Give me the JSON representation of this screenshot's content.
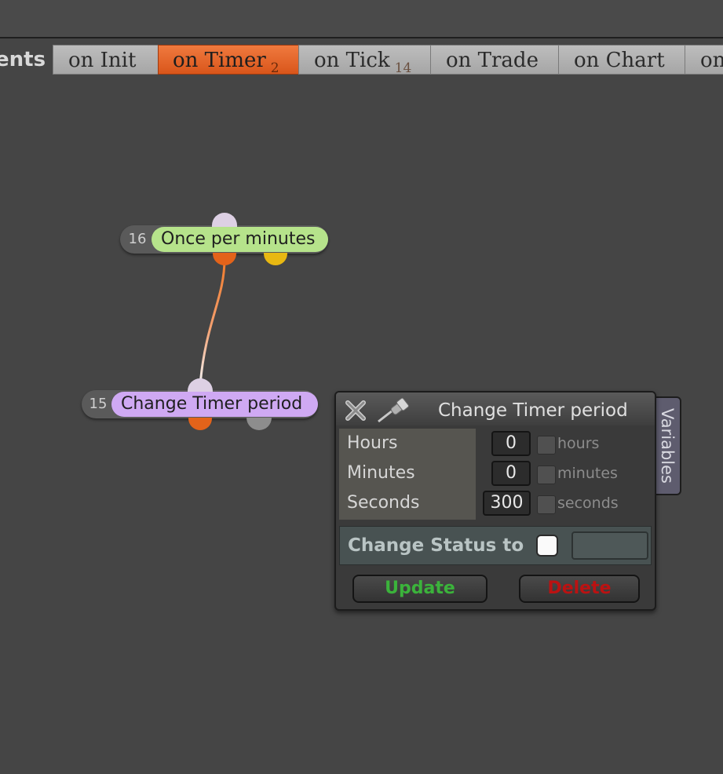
{
  "tabs": [
    {
      "label": "ents",
      "badge": ""
    },
    {
      "label": "on Init",
      "badge": ""
    },
    {
      "label": "on Timer",
      "badge": "2",
      "active": true
    },
    {
      "label": "on Tick",
      "badge": "14"
    },
    {
      "label": "on Trade",
      "badge": ""
    },
    {
      "label": "on Chart",
      "badge": ""
    },
    {
      "label": "on",
      "badge": ""
    }
  ],
  "nodes": {
    "once": {
      "number": "16",
      "label": "Once per minutes",
      "color": "#b6e38b"
    },
    "change": {
      "number": "15",
      "label": "Change Timer period",
      "color": "#cfa9f3"
    }
  },
  "colors": {
    "wire": "#f07a2a",
    "port_out": "#e3631a",
    "port_in": "#ddd0e4",
    "port_yellow": "#e8b812",
    "port_grey": "#8d8d8d",
    "update": "#3bb33b",
    "delete": "#bb1212"
  },
  "dialog": {
    "title": "Change Timer period",
    "params": [
      {
        "label": "Hours",
        "value": "0",
        "unit": "hours"
      },
      {
        "label": "Minutes",
        "value": "0",
        "unit": "minutes"
      },
      {
        "label": "Seconds",
        "value": "300",
        "unit": "seconds"
      }
    ],
    "status_label": "Change Status to",
    "update_label": "Update",
    "delete_label": "Delete",
    "side_tab": "Variables",
    "icons": {
      "close": "close-icon",
      "pin": "pin-icon"
    }
  }
}
